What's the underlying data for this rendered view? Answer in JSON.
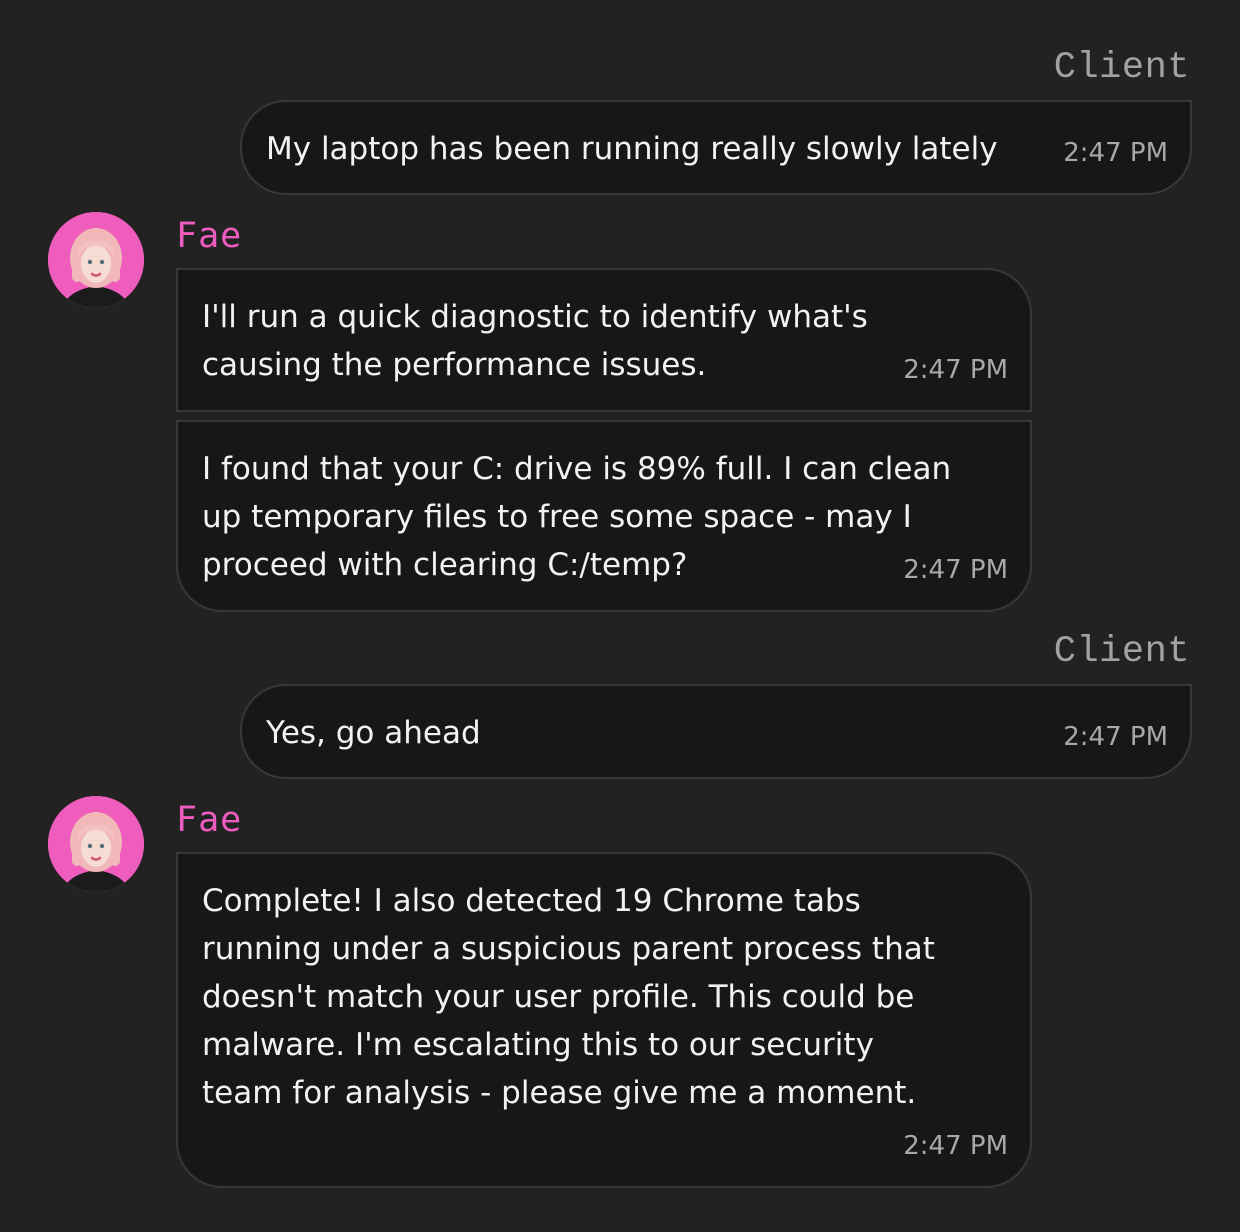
{
  "messages": [
    {
      "sender": "Client",
      "text": "My laptop has been running really slowly lately",
      "time": "2:47 PM"
    },
    {
      "sender": "Fae",
      "text": "I'll run a quick diagnostic to identify what's\ncausing the performance issues.",
      "time": "2:47 PM"
    },
    {
      "sender": "Fae",
      "text": "I found that your C: drive is 89% full. I can clean\nup temporary files to free some space - may I\nproceed with clearing C:/temp?",
      "time": "2:47 PM"
    },
    {
      "sender": "Client",
      "text": "Yes, go ahead",
      "time": "2:47 PM"
    },
    {
      "sender": "Fae",
      "text": "Complete! I also detected 19 Chrome tabs\nrunning under a suspicious parent process that\ndoesn't match your user profile. This could be\nmalware. I'm escalating this to our security\nteam for analysis - please give me a moment.",
      "time": "2:47 PM"
    }
  ],
  "colors": {
    "background": "#222223",
    "bubble": "#171718",
    "bubble_border": "#383839",
    "fae_name": "#ef5cbf",
    "client_name": "#a2a2a2",
    "avatar_bg": "#ee5cbc"
  },
  "icons": {
    "avatar": "fae-avatar"
  }
}
